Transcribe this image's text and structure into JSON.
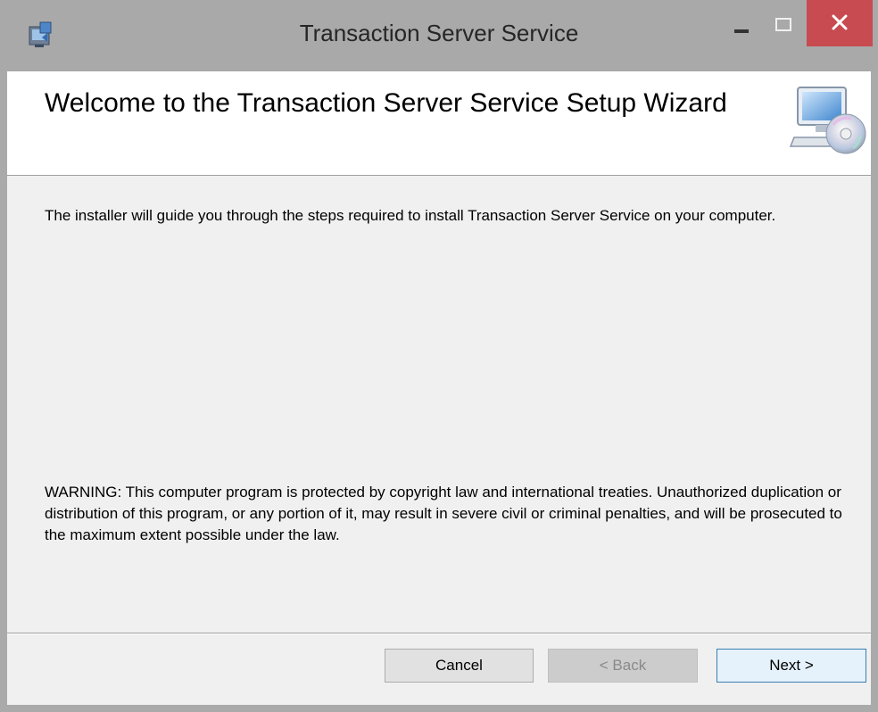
{
  "window": {
    "title": "Transaction Server Service"
  },
  "header": {
    "title": "Welcome to the Transaction Server Service Setup Wizard"
  },
  "body": {
    "intro": "The installer will guide you through the steps required to install Transaction Server Service on your computer.",
    "warning": "WARNING: This computer program is protected by copyright law and international treaties. Unauthorized duplication or distribution of this program, or any portion of it, may result in severe civil or criminal penalties, and will be prosecuted to the maximum extent possible under the law."
  },
  "buttons": {
    "cancel": "Cancel",
    "back": "< Back",
    "next": "Next >"
  },
  "icons": {
    "app": "installer-icon",
    "header": "computer-cd-icon",
    "minimize": "minimize-icon",
    "maximize": "maximize-icon",
    "close": "close-icon"
  },
  "colors": {
    "close_button": "#c74b50",
    "titlebar": "#a9a9a9",
    "dialog_background": "#f0f0f0"
  }
}
